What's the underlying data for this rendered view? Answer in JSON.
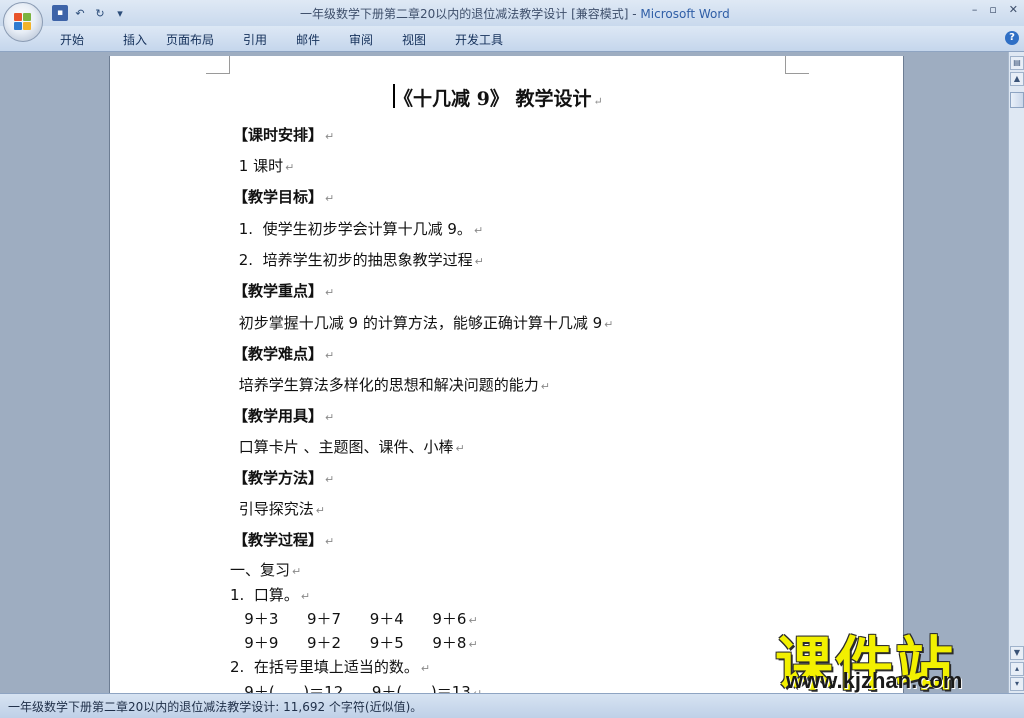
{
  "window": {
    "title_doc": "一年级数学下册第二章20以内的退位减法教学设计 [兼容模式] - ",
    "title_app": "Microsoft Word",
    "controls": [
      "–",
      "▫",
      "✕"
    ]
  },
  "ribbon": {
    "tabs": [
      "开始",
      "插入",
      "页面布局",
      "引用",
      "邮件",
      "审阅",
      "视图",
      "开发工具"
    ]
  },
  "document": {
    "title": "《十几减 9》  教学设计",
    "paragraph_mark": "↵",
    "lines": [
      {
        "text": "【课时安排】",
        "heading": true
      },
      {
        "text": " 1 课时",
        "heading": false
      },
      {
        "text": "【教学目标】",
        "heading": true
      },
      {
        "text": " 1.  使学生初步学会计算十几减 9。",
        "heading": false
      },
      {
        "text": " 2.  培养学生初步的抽思象教学过程",
        "heading": false
      },
      {
        "text": "【教学重点】",
        "heading": true
      },
      {
        "text": " 初步掌握十几减 9 的计算方法，能够正确计算十几减 9",
        "heading": false
      },
      {
        "text": "【教学难点】",
        "heading": true
      },
      {
        "text": " 培养学生算法多样化的思想和解决问题的能力",
        "heading": false
      },
      {
        "text": "【教学用具】",
        "heading": true
      },
      {
        "text": " 口算卡片 、主题图、课件、小棒",
        "heading": false
      },
      {
        "text": "【教学方法】",
        "heading": true
      },
      {
        "text": " 引导探究法",
        "heading": false
      },
      {
        "text": "【教学过程】",
        "heading": true
      },
      {
        "text": "一、复习",
        "heading": false
      },
      {
        "text": "1.  口算。",
        "heading": false
      },
      {
        "text": "   9＋3      9＋7      9＋4      9＋6",
        "heading": false
      },
      {
        "text": "   9＋9      9＋2      9＋5      9＋8",
        "heading": false
      },
      {
        "text": "2.  在括号里填上适当的数。",
        "heading": false
      },
      {
        "text": "   9＋(      )＝12      9＋(      )＝13",
        "heading": false
      }
    ]
  },
  "statusbar": {
    "text": "一年级数学下册第二章20以内的退位减法教学设计: 11,692 个字符(近似值)。"
  },
  "watermark": {
    "cn": "课件站",
    "url": "www.kjzhan.com"
  }
}
